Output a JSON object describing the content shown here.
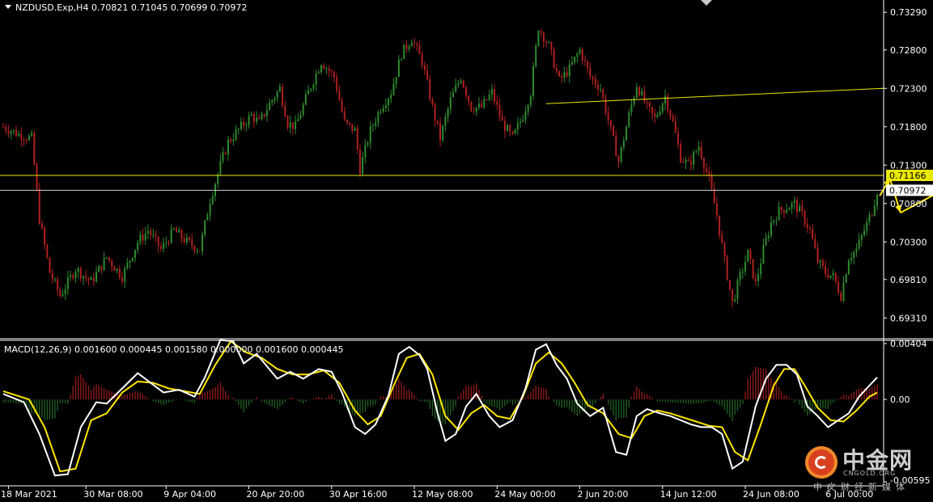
{
  "price_caption": "NZDUSD.Exp,H4  0.70821 0.71045 0.70699 0.70972",
  "macd_caption": "MACD(12,26,9) 0.001600 0.000445 0.001580 0.000000 0.001600 0.000445",
  "watermark": {
    "title": "中金网",
    "subtitle": "CNGOLD.ORG",
    "tagline": "中文财经新媒体"
  },
  "colors": {
    "background": "#000000",
    "bull": "#2e8b2e",
    "bear": "#b02020",
    "current_price": "#d0d0d0",
    "level_line": "#e8e800",
    "trend_line": "#e8e800",
    "forecast_arrow": "#ffe600",
    "macd_line": "#ffffff",
    "signal_line": "#ffe600",
    "hist_positive": "#8b1a1a",
    "hist_negative": "#1f5e1f"
  },
  "chart_data": [
    {
      "type": "candlestick",
      "symbol": "NZDUSD.Exp",
      "timeframe": "H4",
      "ohlc_last": {
        "open": 0.70821,
        "high": 0.71045,
        "low": 0.70699,
        "close": 0.70972
      },
      "ylim": [
        0.6905,
        0.7345
      ],
      "y_ticks": [
        "0.73290",
        "0.72800",
        "0.72300",
        "0.71800",
        "0.71300",
        "0.70800",
        "0.70300",
        "0.69810",
        "0.69310"
      ],
      "price_labels": [
        {
          "name": "level",
          "value": 0.71166,
          "text": "0.71166"
        },
        {
          "name": "current",
          "value": 0.70972,
          "text": "0.70972"
        }
      ],
      "x_labels": [
        "18 Mar 2021",
        "30 Mar 08:00",
        "9 Apr 04:00",
        "20 Apr 20:00",
        "30 Apr 16:00",
        "12 May 08:00",
        "24 May 00:00",
        "2 Jun 20:00",
        "14 Jun 12:00",
        "24 Jun 08:00",
        "6 Jul 00:00"
      ],
      "close_path": [
        [
          0,
          0.718
        ],
        [
          6,
          0.717
        ],
        [
          11,
          0.7165
        ],
        [
          14,
          0.706
        ],
        [
          18,
          0.699
        ],
        [
          22,
          0.696
        ],
        [
          28,
          0.6995
        ],
        [
          34,
          0.6978
        ],
        [
          40,
          0.701
        ],
        [
          46,
          0.6985
        ],
        [
          52,
          0.703
        ],
        [
          56,
          0.7045
        ],
        [
          61,
          0.702
        ],
        [
          66,
          0.7045
        ],
        [
          71,
          0.703
        ],
        [
          76,
          0.702
        ],
        [
          80,
          0.7085
        ],
        [
          84,
          0.713
        ],
        [
          87,
          0.716
        ],
        [
          92,
          0.718
        ],
        [
          96,
          0.7195
        ],
        [
          99,
          0.7185
        ],
        [
          103,
          0.721
        ],
        [
          107,
          0.723
        ],
        [
          110,
          0.7185
        ],
        [
          113,
          0.718
        ],
        [
          118,
          0.7225
        ],
        [
          123,
          0.7265
        ],
        [
          128,
          0.7245
        ],
        [
          132,
          0.7185
        ],
        [
          136,
          0.7175
        ],
        [
          138,
          0.7125
        ],
        [
          142,
          0.7175
        ],
        [
          146,
          0.7205
        ],
        [
          150,
          0.7225
        ],
        [
          154,
          0.7275
        ],
        [
          158,
          0.7295
        ],
        [
          162,
          0.7265
        ],
        [
          166,
          0.7205
        ],
        [
          169,
          0.7165
        ],
        [
          173,
          0.7215
        ],
        [
          177,
          0.7245
        ],
        [
          181,
          0.7205
        ],
        [
          185,
          0.7205
        ],
        [
          189,
          0.7225
        ],
        [
          193,
          0.7185
        ],
        [
          197,
          0.7165
        ],
        [
          201,
          0.7195
        ],
        [
          204,
          0.7225
        ],
        [
          207,
          0.731
        ],
        [
          211,
          0.7285
        ],
        [
          215,
          0.724
        ],
        [
          219,
          0.7255
        ],
        [
          223,
          0.728
        ],
        [
          227,
          0.7245
        ],
        [
          231,
          0.723
        ],
        [
          235,
          0.7175
        ],
        [
          238,
          0.7135
        ],
        [
          242,
          0.7195
        ],
        [
          245,
          0.7235
        ],
        [
          249,
          0.7205
        ],
        [
          252,
          0.719
        ],
        [
          256,
          0.722
        ],
        [
          259,
          0.7185
        ],
        [
          262,
          0.714
        ],
        [
          265,
          0.713
        ],
        [
          269,
          0.7155
        ],
        [
          273,
          0.711
        ],
        [
          276,
          0.7065
        ],
        [
          279,
          0.7005
        ],
        [
          282,
          0.695
        ],
        [
          285,
          0.6985
        ],
        [
          288,
          0.7015
        ],
        [
          291,
          0.6975
        ],
        [
          294,
          0.702
        ],
        [
          297,
          0.7055
        ],
        [
          300,
          0.707
        ],
        [
          303,
          0.7075
        ],
        [
          306,
          0.708
        ],
        [
          309,
          0.7065
        ],
        [
          312,
          0.7045
        ],
        [
          315,
          0.7005
        ],
        [
          318,
          0.699
        ],
        [
          321,
          0.6985
        ],
        [
          324,
          0.696
        ],
        [
          327,
          0.701
        ],
        [
          330,
          0.702
        ],
        [
          333,
          0.7045
        ],
        [
          336,
          0.707
        ],
        [
          338,
          0.7097
        ]
      ],
      "horizontal_levels": [
        0.71166,
        0.70972
      ],
      "trend_line": {
        "from": [
          210,
          0.721
        ],
        "to": [
          380,
          0.723
        ]
      },
      "forecast_arrows": [
        {
          "from": [
            339,
            0.709
          ],
          "to": [
            343,
            0.7113
          ]
        },
        {
          "from": [
            343,
            0.7112
          ],
          "to": [
            347,
            0.7068
          ]
        },
        {
          "from": [
            347,
            0.7068
          ],
          "to": [
            362,
            0.7095
          ]
        },
        {
          "from": [
            362,
            0.7095
          ],
          "to": [
            371,
            0.7
          ]
        },
        {
          "from": [
            371,
            0.7
          ],
          "to": [
            379,
            0.703
          ]
        },
        {
          "from": [
            382,
            0.702
          ],
          "to": [
            386,
            0.6935
          ]
        }
      ],
      "bars_visible": 339
    },
    {
      "type": "macd",
      "params": "MACD(12,26,9)",
      "values": [
        0.0016,
        0.000445,
        0.00158,
        0.0,
        0.0016,
        0.000445
      ],
      "ylim": [
        -0.00595,
        0.00404
      ],
      "y_ticks": [
        {
          "value": 0.00404,
          "text": "0.00404"
        },
        {
          "value": 0.0,
          "text": "0.00"
        },
        {
          "value": -0.00595,
          "text": "-0.00595"
        }
      ],
      "macd_path": [
        [
          0,
          0.0004
        ],
        [
          8,
          -0.0002
        ],
        [
          14,
          -0.0025
        ],
        [
          20,
          -0.0055
        ],
        [
          25,
          -0.0054
        ],
        [
          30,
          -0.002
        ],
        [
          36,
          -0.0002
        ],
        [
          40,
          -0.0003
        ],
        [
          46,
          0.0008
        ],
        [
          52,
          0.0019
        ],
        [
          57,
          0.0012
        ],
        [
          62,
          0.0005
        ],
        [
          68,
          0.0007
        ],
        [
          74,
          0.0002
        ],
        [
          78,
          0.0016
        ],
        [
          84,
          0.0043
        ],
        [
          89,
          0.0042
        ],
        [
          93,
          0.0026
        ],
        [
          98,
          0.0033
        ],
        [
          102,
          0.0024
        ],
        [
          106,
          0.0015
        ],
        [
          111,
          0.002
        ],
        [
          116,
          0.0015
        ],
        [
          122,
          0.0022
        ],
        [
          127,
          0.002
        ],
        [
          131,
          0.0005
        ],
        [
          136,
          -0.002
        ],
        [
          140,
          -0.0025
        ],
        [
          144,
          -0.0018
        ],
        [
          149,
          0.0003
        ],
        [
          153,
          0.0033
        ],
        [
          157,
          0.0038
        ],
        [
          161,
          0.0032
        ],
        [
          164,
          0.0022
        ],
        [
          168,
          -0.001
        ],
        [
          171,
          -0.003
        ],
        [
          175,
          -0.0025
        ],
        [
          179,
          -0.0005
        ],
        [
          183,
          0.0004
        ],
        [
          188,
          -0.0012
        ],
        [
          192,
          -0.002
        ],
        [
          197,
          -0.0015
        ],
        [
          202,
          0.0008
        ],
        [
          206,
          0.0036
        ],
        [
          210,
          0.004
        ],
        [
          214,
          0.0025
        ],
        [
          218,
          0.0015
        ],
        [
          222,
          -0.0003
        ],
        [
          227,
          -0.0012
        ],
        [
          232,
          -0.0006
        ],
        [
          237,
          -0.0038
        ],
        [
          241,
          -0.004
        ],
        [
          245,
          -0.0012
        ],
        [
          249,
          -0.0007
        ],
        [
          254,
          -0.001
        ],
        [
          258,
          -0.0012
        ],
        [
          262,
          -0.0015
        ],
        [
          266,
          -0.0018
        ],
        [
          270,
          -0.002
        ],
        [
          274,
          -0.002
        ],
        [
          278,
          -0.0025
        ],
        [
          282,
          -0.005
        ],
        [
          286,
          -0.0045
        ],
        [
          291,
          -0.0005
        ],
        [
          295,
          0.0015
        ],
        [
          299,
          0.0025
        ],
        [
          303,
          0.0025
        ],
        [
          307,
          0.0018
        ],
        [
          311,
          -0.0005
        ],
        [
          315,
          -0.0012
        ],
        [
          319,
          -0.002
        ],
        [
          323,
          -0.0015
        ],
        [
          327,
          -0.001
        ],
        [
          331,
          0.0002
        ],
        [
          335,
          0.001
        ],
        [
          338,
          0.0016
        ]
      ],
      "signal_path": [
        [
          0,
          0.0006
        ],
        [
          10,
          0.0
        ],
        [
          16,
          -0.002
        ],
        [
          22,
          -0.0052
        ],
        [
          28,
          -0.005
        ],
        [
          34,
          -0.0015
        ],
        [
          40,
          -0.001
        ],
        [
          46,
          0.0005
        ],
        [
          52,
          0.0013
        ],
        [
          58,
          0.0012
        ],
        [
          64,
          0.0008
        ],
        [
          70,
          0.0006
        ],
        [
          76,
          0.0004
        ],
        [
          82,
          0.0025
        ],
        [
          88,
          0.0042
        ],
        [
          94,
          0.0034
        ],
        [
          100,
          0.003
        ],
        [
          106,
          0.0022
        ],
        [
          112,
          0.0018
        ],
        [
          118,
          0.0018
        ],
        [
          124,
          0.0021
        ],
        [
          130,
          0.0012
        ],
        [
          136,
          -0.0008
        ],
        [
          141,
          -0.0018
        ],
        [
          146,
          -0.0012
        ],
        [
          151,
          0.001
        ],
        [
          156,
          0.003
        ],
        [
          161,
          0.0033
        ],
        [
          166,
          0.0018
        ],
        [
          171,
          -0.0012
        ],
        [
          176,
          -0.0022
        ],
        [
          181,
          -0.001
        ],
        [
          186,
          -0.0004
        ],
        [
          191,
          -0.0012
        ],
        [
          196,
          -0.0014
        ],
        [
          201,
          0.0002
        ],
        [
          206,
          0.0026
        ],
        [
          211,
          0.0034
        ],
        [
          216,
          0.0026
        ],
        [
          221,
          0.0012
        ],
        [
          226,
          -0.0004
        ],
        [
          232,
          -0.001
        ],
        [
          238,
          -0.0025
        ],
        [
          243,
          -0.0028
        ],
        [
          248,
          -0.0012
        ],
        [
          253,
          -0.0008
        ],
        [
          258,
          -0.001
        ],
        [
          263,
          -0.0013
        ],
        [
          268,
          -0.0016
        ],
        [
          273,
          -0.0019
        ],
        [
          278,
          -0.002
        ],
        [
          283,
          -0.0038
        ],
        [
          288,
          -0.0044
        ],
        [
          293,
          -0.0018
        ],
        [
          298,
          0.001
        ],
        [
          302,
          0.0022
        ],
        [
          306,
          0.0022
        ],
        [
          310,
          0.001
        ],
        [
          315,
          -0.0006
        ],
        [
          320,
          -0.0015
        ],
        [
          325,
          -0.0016
        ],
        [
          330,
          -0.0008
        ],
        [
          335,
          0.0002
        ],
        [
          338,
          0.0005
        ]
      ]
    }
  ]
}
